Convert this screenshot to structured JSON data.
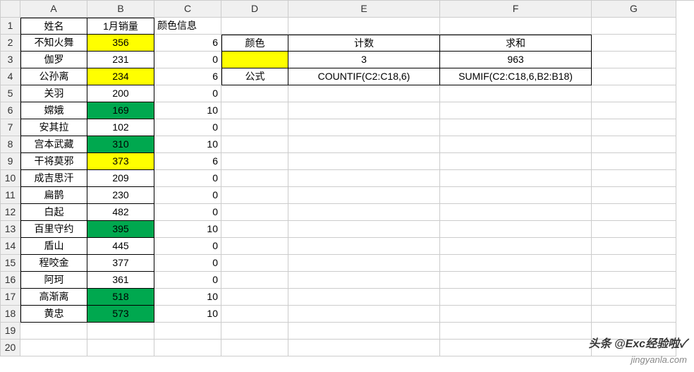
{
  "columns": [
    "A",
    "B",
    "C",
    "D",
    "E",
    "F",
    "G"
  ],
  "rowCount": 20,
  "headers": {
    "A1": "姓名",
    "B1": "1月销量",
    "C1": "颜色信息"
  },
  "info": {
    "D2": "颜色",
    "E2": "计数",
    "F2": "求和",
    "E3": "3",
    "F3": "963",
    "D4": "公式",
    "E4": "COUNTIF(C2:C18,6)",
    "F4": "SUMIF(C2:C18,6,B2:B18)"
  },
  "rows": [
    {
      "name": "不知火舞",
      "sales": "356",
      "code": "6",
      "fill": "yellow"
    },
    {
      "name": "伽罗",
      "sales": "231",
      "code": "0",
      "fill": ""
    },
    {
      "name": "公孙离",
      "sales": "234",
      "code": "6",
      "fill": "yellow"
    },
    {
      "name": "关羽",
      "sales": "200",
      "code": "0",
      "fill": ""
    },
    {
      "name": "嫦娥",
      "sales": "169",
      "code": "10",
      "fill": "green"
    },
    {
      "name": "安其拉",
      "sales": "102",
      "code": "0",
      "fill": ""
    },
    {
      "name": "宫本武藏",
      "sales": "310",
      "code": "10",
      "fill": "green"
    },
    {
      "name": "干将莫邪",
      "sales": "373",
      "code": "6",
      "fill": "yellow"
    },
    {
      "name": "成吉思汗",
      "sales": "209",
      "code": "0",
      "fill": ""
    },
    {
      "name": "扁鹊",
      "sales": "230",
      "code": "0",
      "fill": ""
    },
    {
      "name": "白起",
      "sales": "482",
      "code": "0",
      "fill": ""
    },
    {
      "name": "百里守约",
      "sales": "395",
      "code": "10",
      "fill": "green"
    },
    {
      "name": "盾山",
      "sales": "445",
      "code": "0",
      "fill": ""
    },
    {
      "name": "程咬金",
      "sales": "377",
      "code": "0",
      "fill": ""
    },
    {
      "name": "阿珂",
      "sales": "361",
      "code": "0",
      "fill": ""
    },
    {
      "name": "高渐离",
      "sales": "518",
      "code": "10",
      "fill": "green"
    },
    {
      "name": "黄忠",
      "sales": "573",
      "code": "10",
      "fill": "green"
    }
  ],
  "watermark1": "jingyanla.com",
  "watermark2": "头条 @Exc经验啦✓",
  "chart_data": {
    "type": "table",
    "title": "1月销量",
    "columns": [
      "姓名",
      "1月销量",
      "颜色信息"
    ],
    "data": [
      [
        "不知火舞",
        356,
        6
      ],
      [
        "伽罗",
        231,
        0
      ],
      [
        "公孙离",
        234,
        6
      ],
      [
        "关羽",
        200,
        0
      ],
      [
        "嫦娥",
        169,
        10
      ],
      [
        "安其拉",
        102,
        0
      ],
      [
        "宫本武藏",
        310,
        10
      ],
      [
        "干将莫邪",
        373,
        6
      ],
      [
        "成吉思汗",
        209,
        0
      ],
      [
        "扁鹊",
        230,
        0
      ],
      [
        "白起",
        482,
        0
      ],
      [
        "百里守约",
        395,
        10
      ],
      [
        "盾山",
        445,
        0
      ],
      [
        "程咬金",
        377,
        0
      ],
      [
        "阿珂",
        361,
        0
      ],
      [
        "高渐离",
        518,
        10
      ],
      [
        "黄忠",
        573,
        10
      ]
    ],
    "summary": {
      "color_filter": "yellow (code 6)",
      "count": 3,
      "sum": 963,
      "count_formula": "COUNTIF(C2:C18,6)",
      "sum_formula": "SUMIF(C2:C18,6,B2:B18)"
    }
  }
}
